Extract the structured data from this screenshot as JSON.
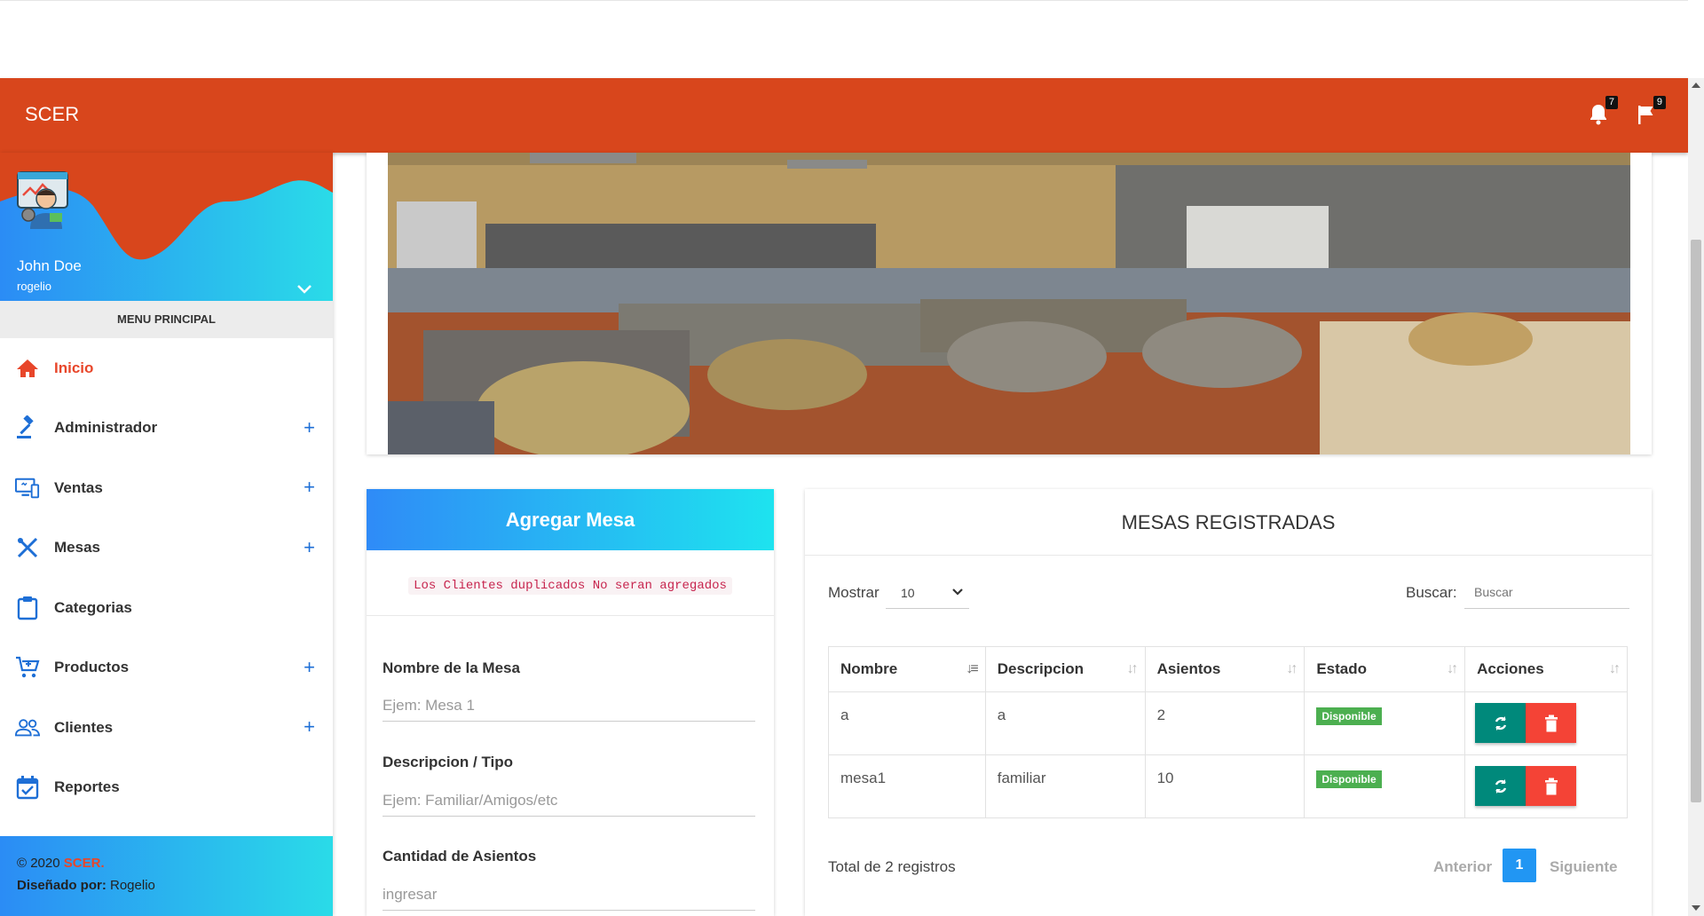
{
  "app": {
    "brand": "SCER"
  },
  "header": {
    "notifications_count": "7",
    "flags_count": "9"
  },
  "user": {
    "name": "John Doe",
    "username": "rogelio"
  },
  "sidebar": {
    "menu_title": "MENU PRINCIPAL",
    "items": [
      {
        "label": "Inicio",
        "icon": "home-icon",
        "expandable": false,
        "active": true
      },
      {
        "label": "Administrador",
        "icon": "gavel-icon",
        "expandable": true
      },
      {
        "label": "Ventas",
        "icon": "monitor-icon",
        "expandable": true
      },
      {
        "label": "Mesas",
        "icon": "cutlery-icon",
        "expandable": true
      },
      {
        "label": "Categorias",
        "icon": "clipboard-icon",
        "expandable": false
      },
      {
        "label": "Productos",
        "icon": "cart-icon",
        "expandable": true
      },
      {
        "label": "Clientes",
        "icon": "people-icon",
        "expandable": true
      },
      {
        "label": "Reportes",
        "icon": "calendar-check-icon",
        "expandable": false
      }
    ],
    "footer": {
      "copyright": "© 2020 ",
      "brand": "SCER.",
      "designed_label": "Diseñado por:",
      "designer": " Rogelio"
    }
  },
  "form": {
    "title": "Agregar Mesa",
    "warning": "Los Clientes duplicados No seran agregados",
    "fields": [
      {
        "label": "Nombre de la Mesa",
        "placeholder": "Ejem: Mesa 1"
      },
      {
        "label": "Descripcion / Tipo",
        "placeholder": "Ejem: Familiar/Amigos/etc"
      },
      {
        "label": "Cantidad de Asientos",
        "placeholder": "ingresar"
      }
    ]
  },
  "table_card": {
    "title": "MESAS REGISTRADAS",
    "show_label": "Mostrar",
    "show_value": "10",
    "search_label": "Buscar:",
    "search_placeholder": "Buscar",
    "columns": [
      "Nombre",
      "Descripcion",
      "Asientos",
      "Estado",
      "Acciones"
    ],
    "rows": [
      {
        "nombre": "a",
        "descripcion": "a",
        "asientos": "2",
        "estado": "Disponible"
      },
      {
        "nombre": "mesa1",
        "descripcion": "familiar",
        "asientos": "10",
        "estado": "Disponible"
      }
    ],
    "total": "Total de 2 registros",
    "pagination": {
      "prev": "Anterior",
      "page": "1",
      "next": "Siguiente"
    }
  },
  "colors": {
    "navbar": "#d8461c",
    "accent_blue": "#1e6fd6",
    "status_green": "#4caf50",
    "sync_teal": "#00897b",
    "delete_red": "#f44336"
  }
}
